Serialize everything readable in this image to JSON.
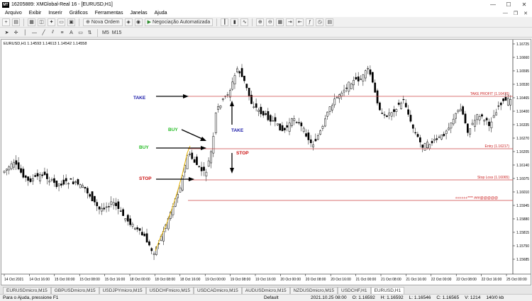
{
  "window": {
    "title": "16205889: XMGlobal-Real 16 - [EURUSD,H1]"
  },
  "menu": {
    "items": [
      "Arquivo",
      "Exibir",
      "Inserir",
      "Gráficos",
      "Ferramentas",
      "Janelas",
      "Ajuda"
    ]
  },
  "toolbar": {
    "new_order": "Nova Ordem",
    "auto_trading": "Negociação Automatizada"
  },
  "toolbar2": {
    "timeframes": [
      "M5",
      "M15"
    ]
  },
  "chart": {
    "symbol_info": "EURUSD,H1  1.14593 1.14613 1.14542 1.14558",
    "price_ticks": [
      "1.16725",
      "1.16660",
      "1.16595",
      "1.16530",
      "1.16465",
      "1.16400",
      "1.16335",
      "1.16270",
      "1.16205",
      "1.16140",
      "1.16075",
      "1.16010",
      "1.15945",
      "1.15880",
      "1.15815",
      "1.15750",
      "1.15685"
    ],
    "time_ticks": [
      "14 Oct 2021",
      "14 Oct 16:00",
      "15 Oct 00:00",
      "15 Oct 08:00",
      "15 Oct 16:00",
      "18 Oct 00:00",
      "18 Oct 08:00",
      "18 Oct 16:00",
      "19 Oct 00:00",
      "19 Oct 08:00",
      "19 Oct 16:00",
      "20 Oct 00:00",
      "20 Oct 08:00",
      "20 Oct 16:00",
      "21 Oct 00:00",
      "21 Oct 08:00",
      "21 Oct 16:00",
      "22 Oct 00:00",
      "22 Oct 08:00",
      "22 Oct 16:00",
      "25 Oct 00:00"
    ],
    "level_labels": {
      "take": "TAKE PROFIT (1.16470)",
      "entry": "Entry (1.16217)",
      "stop": "Stop Loss (1.16065)"
    },
    "annotations": {
      "take_left": "TAKE",
      "buy_diag": "BUY",
      "buy_left": "BUY",
      "stop_left": "STOP",
      "take_mid": "TAKE",
      "stop_mid": "STOP"
    },
    "colors": {
      "take": "#1a1aa8",
      "buy": "#22bb22",
      "stop": "#cc1111",
      "level_line": "#cc4444",
      "trend": "#e8b400",
      "candle": "#000000"
    }
  },
  "tabs": [
    "EURUSDmicro,M15",
    "GBPUSDmicro,M15",
    "USDJPYmicro,M15",
    "USDCHFmicro,M15",
    "USDCADmicro,M15",
    "AUDUSDmicro,M15",
    "NZDUSDmicro,M15",
    "USDCHF,H1",
    "EURUSD,H1"
  ],
  "status": {
    "help": "Para o Ajuda, pressione F1",
    "profile": "Default",
    "datetime": "2021.10.25 08:00",
    "open": "O: 1.16592",
    "high": "H: 1.16592",
    "low": "L: 1.16546",
    "close": "C: 1.16565",
    "volume": "V: 1214",
    "traffic": "140/0 kb"
  }
}
